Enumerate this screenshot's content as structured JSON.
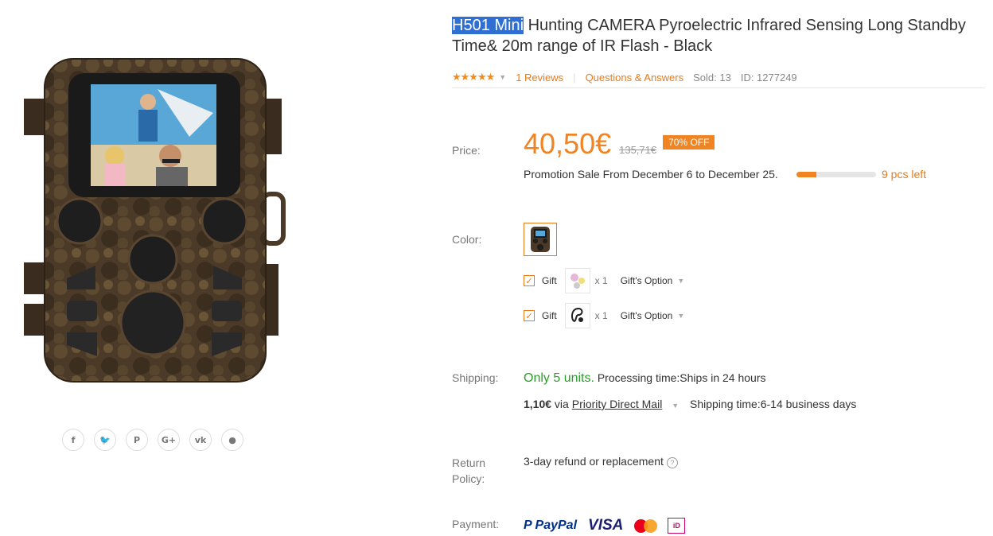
{
  "product": {
    "title_highlight": "H501 Mini",
    "title_rest": " Hunting CAMERA Pyroelectric Infrared Sensing Long Standby Time& 20m range of IR Flash - Black",
    "rating_stars": 5,
    "reviews": "1 Reviews",
    "qa": "Questions & Answers",
    "sold": "Sold: 13",
    "id": "ID: 1277249"
  },
  "price": {
    "label": "Price:",
    "current": "40,50€",
    "old": "135,71€",
    "discount": "70% OFF",
    "promo": "Promotion Sale From December 6 to December 25.",
    "stock_fill": 0.25,
    "pcs_left": "9 pcs left"
  },
  "color": {
    "label": "Color:"
  },
  "gifts": [
    {
      "label": "Gift",
      "qty": "x 1",
      "option": "Gift's Option",
      "icon": "gift-toy-icon"
    },
    {
      "label": "Gift",
      "qty": "x 1",
      "option": "Gift's Option",
      "icon": "gift-earphone-icon"
    }
  ],
  "shipping": {
    "label": "Shipping:",
    "units": "Only 5 units.",
    "processing": " Processing time:Ships in 24 hours",
    "cost": "1,10€",
    "via": " via ",
    "method": "Priority Direct Mail",
    "time": "Shipping time:6-14 business days"
  },
  "return_policy": {
    "label_line1": "Return",
    "label_line2": "Policy:",
    "text": "3-day refund or replacement"
  },
  "payment": {
    "label": "Payment:",
    "methods": [
      "PayPal",
      "VISA",
      "MasterCard",
      "iDEAL"
    ]
  },
  "share": [
    "facebook-icon",
    "twitter-icon",
    "pinterest-icon",
    "google-plus-icon",
    "vk-icon",
    "reddit-icon"
  ],
  "share_glyphs": [
    "f",
    "🐦",
    "P",
    "G+",
    "vk",
    "●"
  ],
  "colors": {
    "accent": "#f08322",
    "green": "#2a9d2a",
    "highlight": "#2f6fd1"
  }
}
